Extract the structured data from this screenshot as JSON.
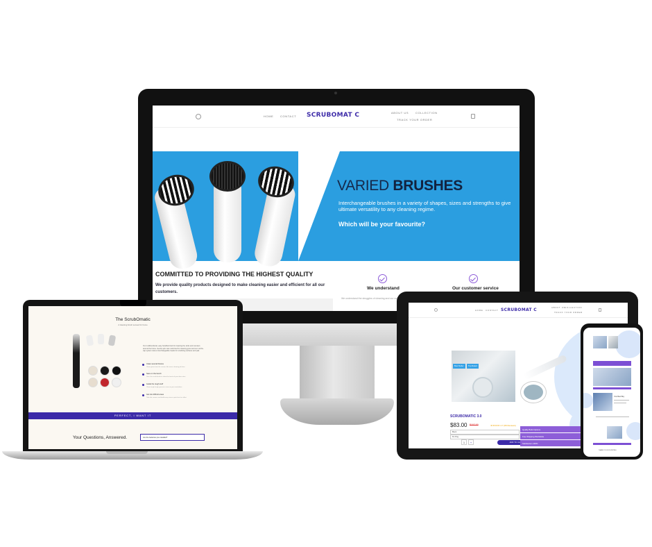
{
  "colors": {
    "brand_purple": "#3d2ba8",
    "hero_blue": "#2b9ee0",
    "accent_violet": "#8d5ed8"
  },
  "desktop": {
    "nav": {
      "home": "HOME",
      "contact": "CONTACT",
      "logo": "SCRUBOMAT C",
      "about": "ABOUT US",
      "collection": "COLLECTION",
      "track": "TRACK YOUR ORDER",
      "search_icon": "search-icon",
      "cart_icon": "cart-icon"
    },
    "hero": {
      "title_light": "VARIED",
      "title_bold": "BRUSHES",
      "subtitle": "Interchangeable brushes in a variety of shapes, sizes and strengths to give ultimate versatility to any cleaning regime.",
      "question": "Which will be your favourite?"
    },
    "commit": {
      "title": "COMMITTED TO PROVIDING THE HIGHEST QUALITY",
      "subtitle": "We provide quality products designed to make cleaning easier and efficient for all our customers."
    },
    "features": [
      {
        "title": "We understand",
        "text": "We understand the struggles of cleaning and our customers, so we created ScrubOmatic that makes"
      },
      {
        "title": "Our customer service",
        "text": ""
      }
    ],
    "review_snippet": "ability at the top"
  },
  "laptop": {
    "title": "The ScrubOmatic",
    "subtitle": "A cleaning brush sensed for home",
    "paragraph": "Our multifunctional, easy handheld tool for cleaning the sinks and counters around the home. Gentle spin rate motorized for cleaning grout and our nozzle-cap system stores interchangeable heads for scrubbing surfaces and pad.",
    "bullets": [
      {
        "label": "Clean several fixtures",
        "desc": "Clean grime from the corners like never cleaning job here"
      },
      {
        "label": "Save on the bench",
        "desc": "Use it for scrub brush to clean the knots of your drain sites"
      },
      {
        "label": "Guide the tough stuff",
        "desc": "Clean tough lough grease to save on your neutralizer"
      },
      {
        "label": "Get into difficult areas",
        "desc": "Take the corners and build every stress spots best to collect"
      }
    ],
    "cta": "PERFECT, I WANT IT",
    "faq_title": "Your Questions, Answered.",
    "faq_select": "Are the batteries pre-installed?"
  },
  "tablet": {
    "nav": {
      "home": "HOME",
      "contact": "CONTACT",
      "logo": "SCRUBOMAT C",
      "about": "ABOUT US",
      "collection": "COLLECTION",
      "track": "TRACK YOUR ORDER"
    },
    "photo_tags": [
      "Best Seller",
      "Top Rated"
    ],
    "product_name": "SCRUBOMATIC 3.0",
    "price": "$83.00",
    "old_price": "$107.00",
    "stars": "★★★★★ 4.7 (89 Reviews)",
    "option_1": "Black",
    "option_2": "8in Plug",
    "qty": "1",
    "add_to_cart": "ADD TO CART",
    "accordion": [
      "Quality Build Options",
      "Free Shipping Worldwide",
      "Satisfaction 100%"
    ]
  },
  "phone": {
    "headline": "Your Best Buy",
    "footer": "THANK YOU FOR VISITING"
  }
}
